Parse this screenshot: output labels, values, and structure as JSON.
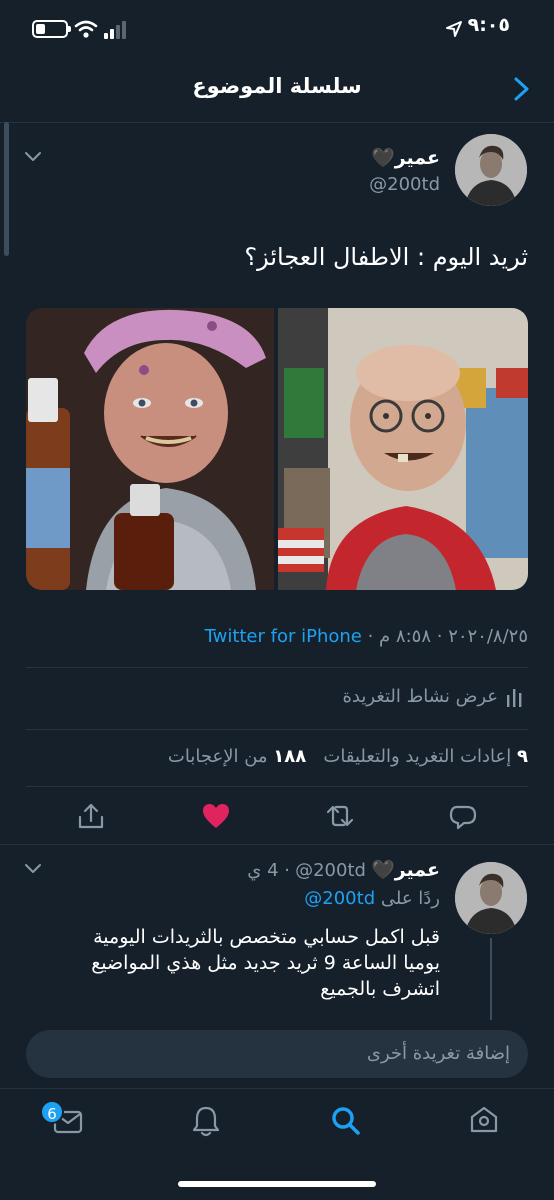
{
  "status": {
    "time": "٩:٠٥"
  },
  "header": {
    "title": "سلسلة الموضوع"
  },
  "tweet": {
    "name": "عمير🖤",
    "handle": "@200td",
    "text": "ثريد اليوم : الاطفال العجائز؟",
    "date": "٢٠٢٠/٨/٢٥",
    "time": "٨:٥٨ م",
    "client": "Twitter for iPhone",
    "activity_label": "عرض نشاط التغريدة",
    "stats": {
      "retweets_count": "٩",
      "retweets_label": "إعادات التغريد والتعليقات",
      "likes_count": "١٨٨",
      "likes_label": "من الإعجابات"
    },
    "liked_color": "#e0245e"
  },
  "reply": {
    "name": "عمير🖤",
    "handle": "@200td",
    "time": "4 ي",
    "replying_prefix": "ردًا على",
    "replying_handle": "@200td",
    "lines": [
      "قبل اكمل حسابي متخصص بالثريدات اليومية",
      "يوميا الساعة 9 ثريد جديد مثل هذي المواضيع",
      "اتشرف بالجميع"
    ]
  },
  "compose": {
    "placeholder": "إضافة تغريدة أخرى"
  },
  "tabbar": {
    "messages_badge": "6"
  },
  "colors": {
    "background": "#15202b",
    "accent": "#1da1f2",
    "secondary_text": "#8899a6"
  }
}
